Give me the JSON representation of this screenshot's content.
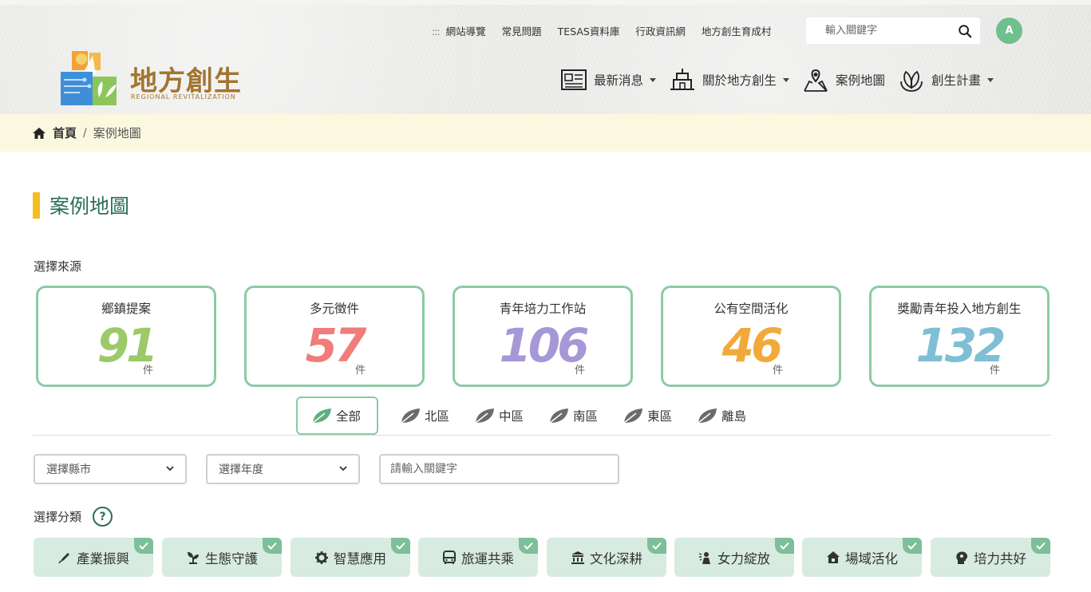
{
  "header": {
    "top_links": [
      {
        "label": "網站導覽",
        "icon": "sitemap-dots"
      },
      {
        "label": "常見問題"
      },
      {
        "label": "TESAS資料庫"
      },
      {
        "label": "行政資訊網"
      },
      {
        "label": "地方創生育成村"
      }
    ],
    "sitemap_marker": ":::",
    "search": {
      "placeholder": "輸入關鍵字",
      "icon": "search-icon"
    },
    "avatar_initial": "A",
    "logo": {
      "title": "地方創生",
      "subtitle": "REGIONAL REVITALIZATION"
    },
    "nav": [
      {
        "label": "最新消息",
        "icon": "newspaper-icon",
        "dropdown": true
      },
      {
        "label": "關於地方創生",
        "icon": "building-icon",
        "dropdown": true
      },
      {
        "label": "案例地圖",
        "icon": "map-pin-icon",
        "dropdown": false
      },
      {
        "label": "創生計畫",
        "icon": "leaf-hand-icon",
        "dropdown": true
      }
    ]
  },
  "breadcrumb": {
    "home": "首頁",
    "separator": "/",
    "current": "案例地圖"
  },
  "page": {
    "title": "案例地圖"
  },
  "source_label": "選擇來源",
  "sources": [
    {
      "title": "鄉鎮提案",
      "count": "91",
      "unit": "件",
      "color": "#9cc96a"
    },
    {
      "title": "多元徵件",
      "count": "57",
      "unit": "件",
      "color": "#f07c7c"
    },
    {
      "title": "青年培力工作站",
      "count": "106",
      "unit": "件",
      "color": "#a697d6"
    },
    {
      "title": "公有空間活化",
      "count": "46",
      "unit": "件",
      "color": "#f2a93b"
    },
    {
      "title": "獎勵青年投入地方創生",
      "count": "132",
      "unit": "件",
      "color": "#7fbfd6"
    }
  ],
  "regions": [
    {
      "label": "全部",
      "active": true
    },
    {
      "label": "北區",
      "active": false
    },
    {
      "label": "中區",
      "active": false
    },
    {
      "label": "南區",
      "active": false
    },
    {
      "label": "東區",
      "active": false
    },
    {
      "label": "離島",
      "active": false
    }
  ],
  "filters": {
    "county": "選擇縣市",
    "year": "選擇年度",
    "keyword_placeholder": "請輸入關鍵字"
  },
  "category_label": "選擇分類",
  "help_symbol": "?",
  "categories": [
    {
      "label": "產業振興",
      "icon": "pen-icon",
      "checked": true
    },
    {
      "label": "生態守護",
      "icon": "sprout-icon",
      "checked": true
    },
    {
      "label": "智慧應用",
      "icon": "gear-icon",
      "checked": true
    },
    {
      "label": "旅運共乘",
      "icon": "bus-icon",
      "checked": true
    },
    {
      "label": "文化深耕",
      "icon": "temple-icon",
      "checked": true
    },
    {
      "label": "女力綻放",
      "icon": "woman-icon",
      "checked": true
    },
    {
      "label": "場域活化",
      "icon": "house-icon",
      "checked": true
    },
    {
      "label": "培力共好",
      "icon": "head-icon",
      "checked": true
    }
  ],
  "colors": {
    "accent_green": "#2a6f52",
    "card_border": "#8ccaa6",
    "chip_bg": "#d7ebe0",
    "title_bar": "#f5bd1f",
    "breadcrumb_bg": "#fbf8e0",
    "avatar_bg": "#6fbf8f"
  }
}
